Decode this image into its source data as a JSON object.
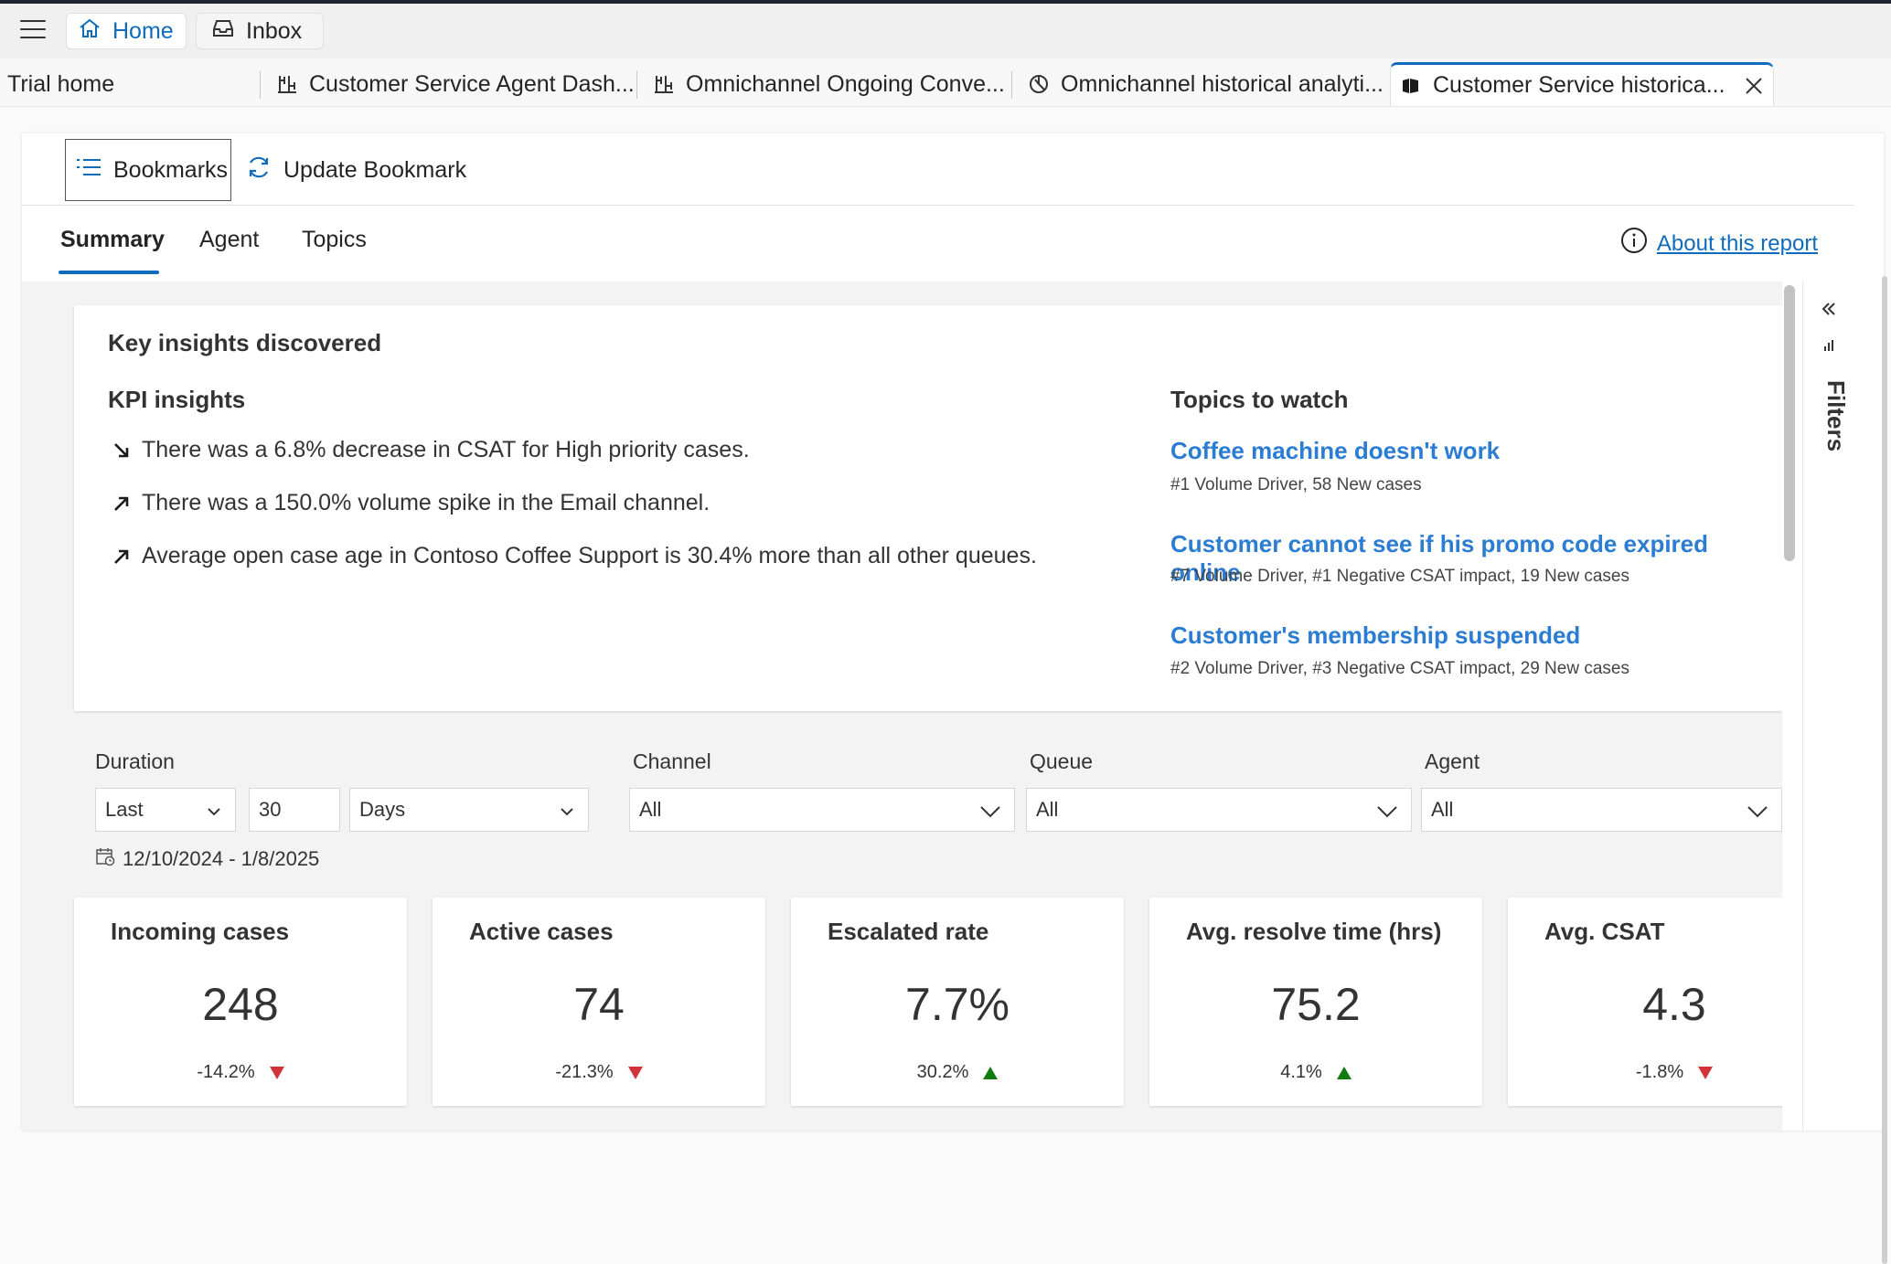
{
  "topbar": {
    "home_label": "Home",
    "inbox_label": "Inbox"
  },
  "tabs": {
    "trial_home": "Trial home",
    "items": [
      {
        "label": "Customer Service Agent Dash..."
      },
      {
        "label": "Omnichannel Ongoing Conve..."
      },
      {
        "label": "Omnichannel historical analyti..."
      },
      {
        "label": "Customer Service historica..."
      }
    ]
  },
  "toolbar": {
    "bookmarks_label": "Bookmarks",
    "update_label": "Update Bookmark"
  },
  "report_tabs": {
    "items": [
      "Summary",
      "Agent",
      "Topics"
    ],
    "active": "Summary",
    "about_label": "About this report"
  },
  "insights": {
    "title": "Key insights discovered",
    "kpi_title": "KPI insights",
    "kpi_items": [
      {
        "text": "There was a 6.8% decrease in CSAT for High priority cases.",
        "direction": "down"
      },
      {
        "text": "There was a 150.0% volume spike in the Email channel.",
        "direction": "up"
      },
      {
        "text": "Average open case age in Contoso Coffee Support is 30.4% more than all other queues.",
        "direction": "up"
      }
    ],
    "topics_title": "Topics to watch",
    "topics": [
      {
        "name": "Coffee machine doesn't work",
        "detail": "#1 Volume Driver, 58 New cases"
      },
      {
        "name": "Customer cannot see if his promo code expired online",
        "detail": "#7 Volume Driver, #1 Negative CSAT impact, 19 New cases"
      },
      {
        "name": "Customer's membership suspended",
        "detail": "#2 Volume Driver, #3 Negative CSAT impact, 29 New cases"
      }
    ]
  },
  "filters": {
    "duration_label": "Duration",
    "duration_mode": "Last",
    "duration_value": "30",
    "duration_unit": "Days",
    "channel_label": "Channel",
    "channel_value": "All",
    "queue_label": "Queue",
    "queue_value": "All",
    "agent_label": "Agent",
    "agent_value": "All",
    "date_range": "12/10/2024 - 1/8/2025",
    "pane_label": "Filters"
  },
  "kpis": [
    {
      "title": "Incoming cases",
      "value": "248",
      "delta": "-14.2%",
      "trend": "down"
    },
    {
      "title": "Active cases",
      "value": "74",
      "delta": "-21.3%",
      "trend": "down"
    },
    {
      "title": "Escalated rate",
      "value": "7.7%",
      "delta": "30.2%",
      "trend": "up"
    },
    {
      "title": "Avg. resolve time (hrs)",
      "value": "75.2",
      "delta": "4.1%",
      "trend": "up"
    },
    {
      "title": "Avg. CSAT",
      "value": "4.3",
      "delta": "-1.8%",
      "trend": "down"
    }
  ],
  "colors": {
    "accent": "#0f6cbd",
    "link": "#2b7cd3",
    "trend_down": "#d13438",
    "trend_up": "#107c10"
  }
}
